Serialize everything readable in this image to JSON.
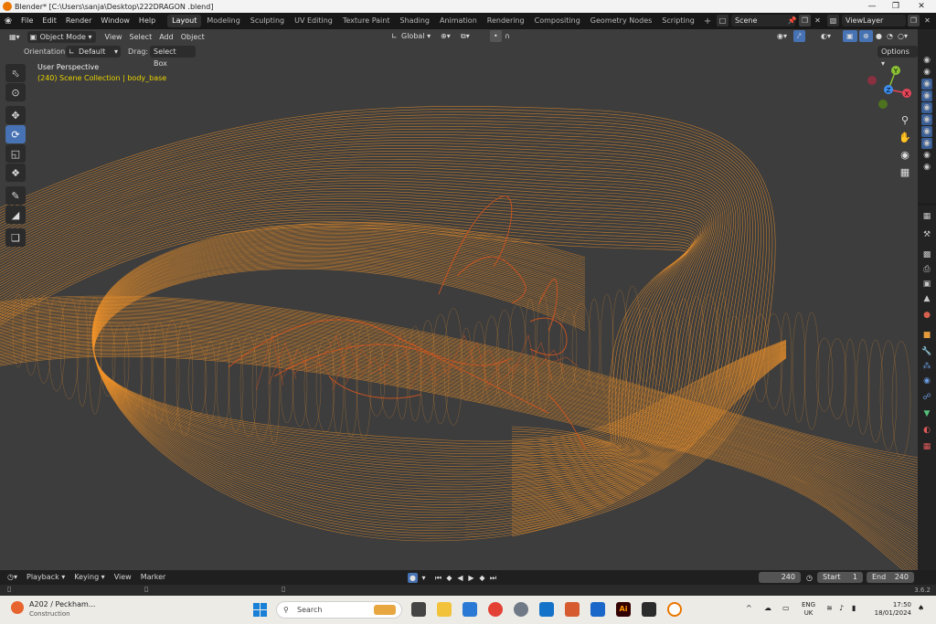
{
  "window": {
    "title": "Blender* [C:\\Users\\sanja\\Desktop\\222DRAGON .blend]",
    "minimize_icon": "minimize-icon",
    "maximize_icon": "restore-icon",
    "close_icon": "close-icon"
  },
  "menu": {
    "items": [
      "File",
      "Edit",
      "Render",
      "Window",
      "Help"
    ]
  },
  "workspaces": {
    "tabs": [
      "Layout",
      "Modeling",
      "Sculpting",
      "UV Editing",
      "Texture Paint",
      "Shading",
      "Animation",
      "Rendering",
      "Compositing",
      "Geometry Nodes",
      "Scripting"
    ],
    "active": "Layout",
    "add_label": "+"
  },
  "scene": {
    "name": "Scene"
  },
  "view_layer": {
    "name": "ViewLayer"
  },
  "viewport_header": {
    "mode": "Object Mode",
    "menus": [
      "View",
      "Select",
      "Add",
      "Object"
    ],
    "transform_orientation": "Global",
    "options_label": "Options"
  },
  "viewport_subheader": {
    "orientation_label": "Orientation:",
    "orientation_value": "Default",
    "drag_label": "Drag:",
    "drag_value": "Select Box"
  },
  "viewport": {
    "perspective_label": "User Perspective",
    "collection_label": "(240) Scene Collection | body_base",
    "wire_color": "#f0932b",
    "inner_wire_color": "#d2541f",
    "background_color": "#3d3d3d"
  },
  "gizmo": {
    "x_label": "X",
    "y_label": "Y",
    "z_label": "Z",
    "x_color": "#e54659",
    "y_color": "#8bc134",
    "z_color": "#3d8ef0"
  },
  "toolbar": {
    "tools": [
      "select-box-icon",
      "cursor-icon",
      "move-icon",
      "rotate-icon",
      "scale-icon",
      "transform-icon",
      "annotate-icon",
      "measure-icon",
      "add-cube-icon"
    ],
    "active": "rotate-icon"
  },
  "timeline": {
    "menus": [
      "Playback",
      "Keying",
      "View",
      "Marker"
    ],
    "current_frame": "240",
    "start_label": "Start",
    "start_value": "1",
    "end_label": "End",
    "end_value": "240"
  },
  "statusbar": {
    "version": "3.6.2"
  },
  "taskbar": {
    "weather_title": "A202 / Peckham...",
    "weather_subtitle": "Construction",
    "search_placeholder": "Search",
    "lang_top": "ENG",
    "lang_bottom": "UK",
    "time": "17:50",
    "date": "18/01/2024"
  }
}
